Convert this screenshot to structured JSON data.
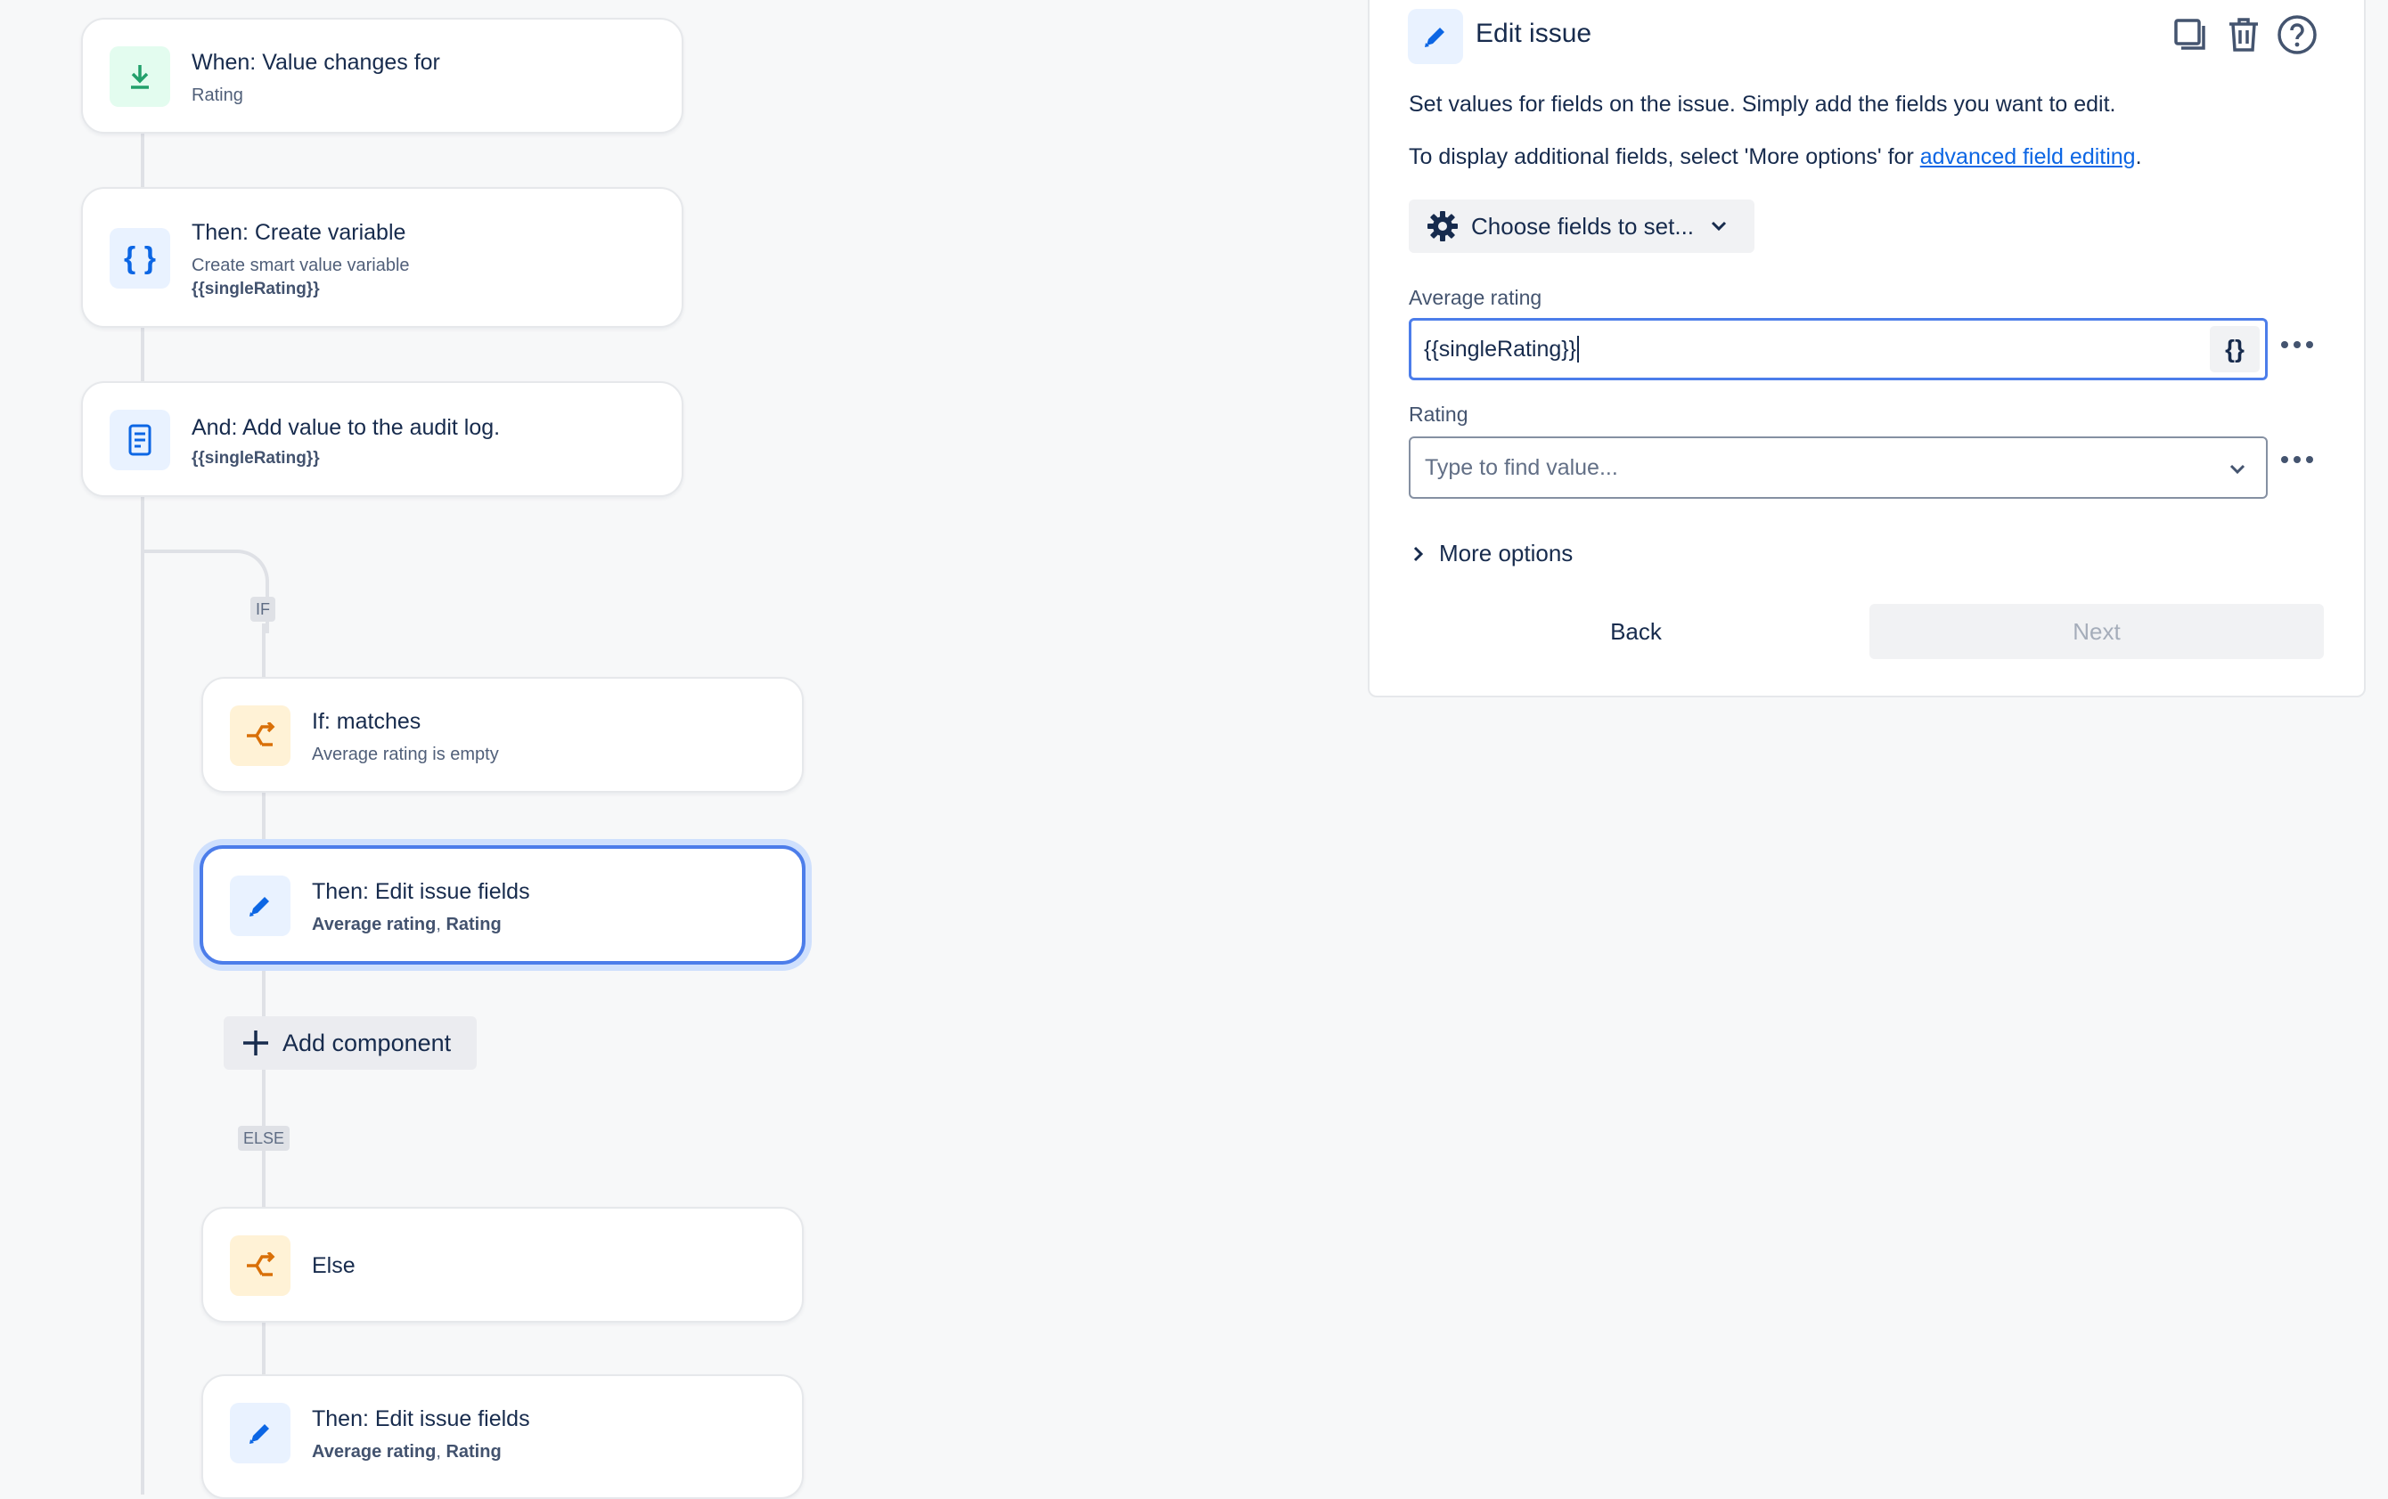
{
  "flow": {
    "trigger": {
      "title": "When: Value changes for",
      "subtitle": "Rating",
      "icon": "download-arrow-icon"
    },
    "create_variable": {
      "title": "Then: Create variable",
      "subtitle": "Create smart value variable",
      "detail": "{{singleRating}}",
      "icon": "braces-icon"
    },
    "audit_log": {
      "title": "And: Add value to the audit log.",
      "detail": "{{singleRating}}",
      "icon": "document-icon"
    },
    "if_label": "IF",
    "if_condition": {
      "title": "If: matches",
      "subtitle": "Average rating is empty",
      "icon": "branch-icon"
    },
    "edit_fields_1": {
      "title": "Then: Edit issue fields",
      "field1": "Average rating",
      "separator": ", ",
      "field2": "Rating",
      "icon": "pencil-icon"
    },
    "add_component": "Add component",
    "else_label": "ELSE",
    "else_block": {
      "title": "Else",
      "icon": "branch-icon"
    },
    "edit_fields_2": {
      "title": "Then: Edit issue fields",
      "field1": "Average rating",
      "separator": ", ",
      "field2": "Rating",
      "icon": "pencil-icon"
    }
  },
  "panel": {
    "title": "Edit issue",
    "description": "Set values for fields on the issue. Simply add the fields you want to edit.",
    "additional_prefix": "To display additional fields, select 'More options' for ",
    "additional_link": "advanced field editing",
    "additional_suffix": ".",
    "choose_fields_label": "Choose fields to set...",
    "fields": [
      {
        "label": "Average rating",
        "value": "{{singleRating}}",
        "smart_value_button": "{}"
      },
      {
        "label": "Rating",
        "placeholder": "Type to find value..."
      }
    ],
    "more_options": "More options",
    "back_label": "Back",
    "next_label": "Next"
  },
  "colors": {
    "accent": "#4c7dea",
    "link": "#0c66e4",
    "trigger_green": "#22a06b",
    "condition_orange": "#d97008"
  }
}
